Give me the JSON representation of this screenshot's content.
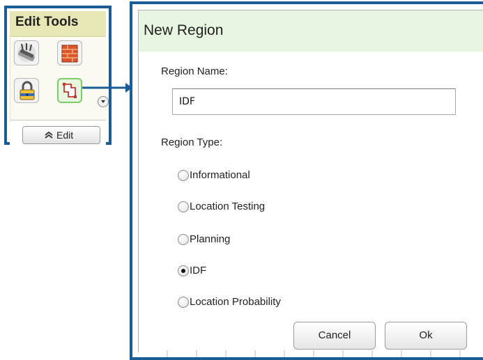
{
  "edit_tools": {
    "title": "Edit Tools",
    "edit_button_label": "Edit",
    "tools": [
      {
        "icon": "router-icon"
      },
      {
        "icon": "wall-icon"
      },
      {
        "icon": "lock-icon"
      },
      {
        "icon": "region-icon",
        "active": true
      }
    ]
  },
  "dialog": {
    "title": "New Region",
    "name_label": "Region Name:",
    "name_value": "IDF",
    "type_label": "Region Type:",
    "region_types": [
      {
        "label": "Informational",
        "selected": false
      },
      {
        "label": "Location Testing",
        "selected": false
      },
      {
        "label": "Planning",
        "selected": false
      },
      {
        "label": "IDF",
        "selected": true
      },
      {
        "label": "Location Probability",
        "selected": false
      }
    ],
    "cancel_label": "Cancel",
    "ok_label": "Ok"
  },
  "colors": {
    "frame_border": "#1a5c96",
    "tools_header_bg": "#e6e7b4",
    "dialog_titlebar_bg": "#e8f5e1",
    "active_tool_border": "#7ccd6a"
  }
}
